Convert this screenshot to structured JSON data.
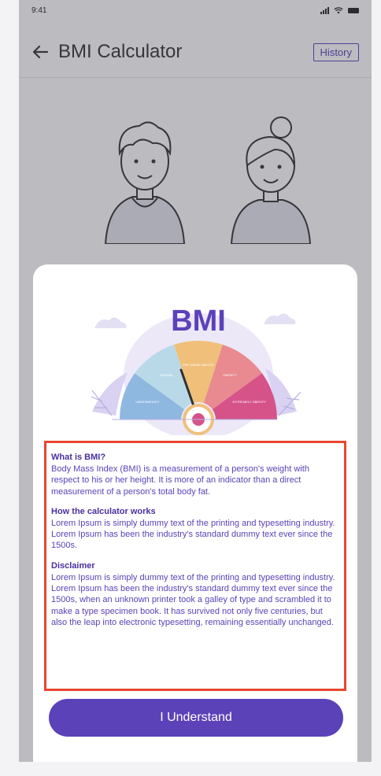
{
  "status_bar": {
    "time": "9:41"
  },
  "app_bar": {
    "title": "BMI Calculator",
    "history_label": "History"
  },
  "modal": {
    "illustration_label": "BMI",
    "gauge_segments": [
      "UNDERWEIGHT",
      "NORMAL",
      "PRE OBESE WEIGHT",
      "OBESITY",
      "EXTREMELY OBESITY"
    ],
    "sections": [
      {
        "heading": "What is BMI?",
        "body": "Body Mass Index (BMI) is a measurement of a person's weight with respect to his or her height. It is more of an indicator than a direct measurement of a person's total body fat."
      },
      {
        "heading": "How the calculator works",
        "body": "Lorem Ipsum is simply dummy text of the printing and typesetting industry. Lorem Ipsum has been the industry's standard dummy text ever since the 1500s."
      },
      {
        "heading": "Disclaimer",
        "body": "Lorem Ipsum is simply dummy text of the printing and typesetting industry. Lorem Ipsum has been the industry's standard dummy text ever since the 1500s, when an unknown printer took a galley of type and scrambled it to make a type specimen book. It has survived not only five centuries, but also the leap into electronic typesetting, remaining essentially unchanged."
      }
    ],
    "button_label": "I Understand"
  },
  "colors": {
    "accent": "#5b42b9",
    "highlight_border": "#e8472e",
    "gauge": [
      "#8fb8e0",
      "#b9d9e8",
      "#f0c07a",
      "#e88a8f",
      "#d6538a"
    ]
  }
}
